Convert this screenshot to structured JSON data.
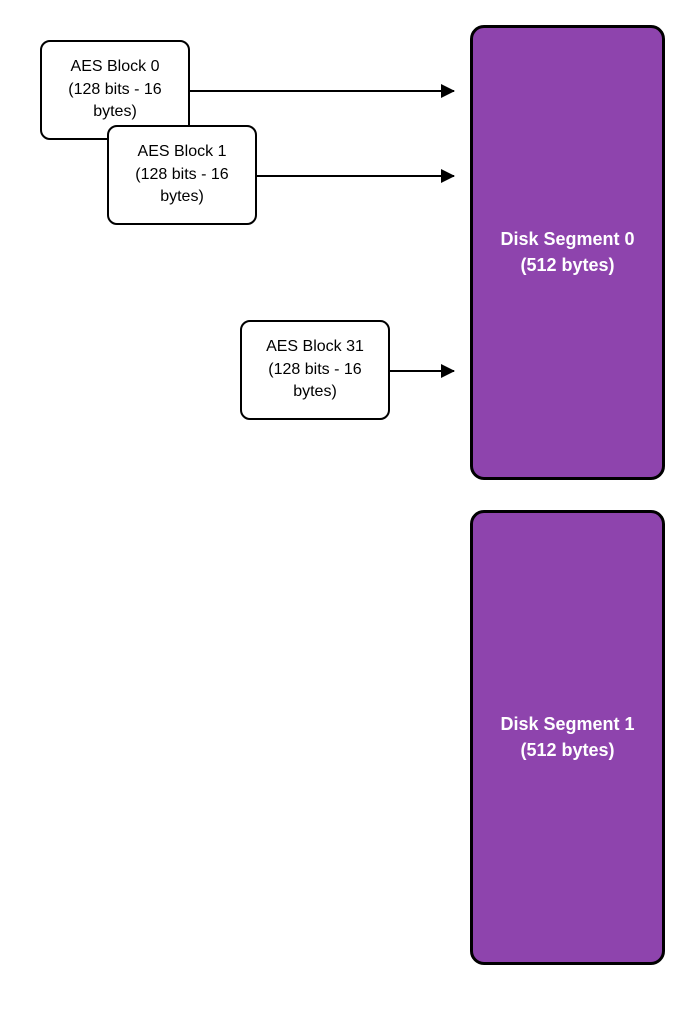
{
  "blocks": {
    "aes0": {
      "title": "AES Block 0",
      "subtitle": "(128 bits - 16 bytes)"
    },
    "aes1": {
      "title": "AES Block 1",
      "subtitle": "(128 bits - 16 bytes)"
    },
    "aes31": {
      "title": "AES Block 31",
      "subtitle": "(128 bits - 16 bytes)"
    }
  },
  "segments": {
    "disk0": {
      "title": "Disk Segment 0",
      "subtitle": "(512 bytes)"
    },
    "disk1": {
      "title": "Disk Segment 1",
      "subtitle": "(512 bytes)"
    }
  },
  "colors": {
    "segment_fill": "#8e44ad",
    "block_fill": "#ffffff",
    "border": "#000000",
    "segment_text": "#ffffff"
  }
}
